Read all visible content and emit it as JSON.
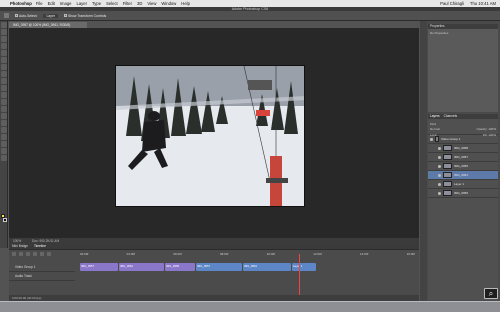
{
  "menubar": {
    "app": "Photoshop",
    "items": [
      "File",
      "Edit",
      "Image",
      "Layer",
      "Type",
      "Select",
      "Filter",
      "3D",
      "View",
      "Window",
      "Help"
    ],
    "user": "Paul Chiragli",
    "clock": "Thu 10:41 AM"
  },
  "window": {
    "title": "Adobe Photoshop CS6"
  },
  "options": {
    "auto_select": "Auto-Select:",
    "auto_select_value": "Layer",
    "transform": "Show Transform Controls"
  },
  "document": {
    "tab": "IMG_0957 @ 100% (IMG_0961, RGB/8)"
  },
  "status": {
    "zoom": "100%",
    "doc": "Doc: 900.2K/11.4M"
  },
  "timeline": {
    "tabs": [
      "Mini Bridge",
      "Timeline"
    ],
    "ruler": [
      "02:00f",
      "04:00f",
      "06:00f",
      "08:00f",
      "10:00f",
      "12:00f",
      "14:00f",
      "16:00f"
    ],
    "tracks": [
      "Video Group 1",
      "Audio Track"
    ],
    "clips": [
      {
        "label": "IMG_0957",
        "color": "purple",
        "w": 38
      },
      {
        "label": "IMG_0961",
        "color": "purple",
        "w": 45
      },
      {
        "label": "IMG_0958",
        "color": "purple",
        "w": 30
      },
      {
        "label": "IMG_0957",
        "color": "blue",
        "w": 46
      },
      {
        "label": "IMG_0961",
        "color": "blue",
        "w": 48
      },
      {
        "label": "Layer 1",
        "color": "blue",
        "w": 24
      }
    ],
    "footer": "0:00:00:00 (30.00 fps)"
  },
  "properties": {
    "title": "Properties",
    "subtitle": "No Properties"
  },
  "layers": {
    "tabs": [
      "Layers",
      "Channels"
    ],
    "kind": "Kind",
    "blend": "Normal",
    "opacity_label": "Opacity:",
    "opacity": "100%",
    "lock": "Lock:",
    "fill_label": "Fill:",
    "fill": "100%",
    "items": [
      {
        "name": "Video Group 1",
        "type": "group",
        "selected": false,
        "indent": false
      },
      {
        "name": "IMG_0958",
        "type": "layer",
        "selected": false,
        "indent": true
      },
      {
        "name": "IMG_0957",
        "type": "layer",
        "selected": false,
        "indent": true
      },
      {
        "name": "IMG_0955",
        "type": "layer",
        "selected": false,
        "indent": true
      },
      {
        "name": "IMG_0961",
        "type": "layer",
        "selected": true,
        "indent": true
      },
      {
        "name": "Layer 1",
        "type": "layer",
        "selected": false,
        "indent": true
      },
      {
        "name": "IMG_0956",
        "type": "layer",
        "selected": false,
        "indent": true
      }
    ]
  },
  "colors": {
    "foreground": "#f4e64a",
    "background": "#111111",
    "accent": "#5d7aa8"
  },
  "icons": {
    "zoom_badge": "magnifier-icon"
  }
}
